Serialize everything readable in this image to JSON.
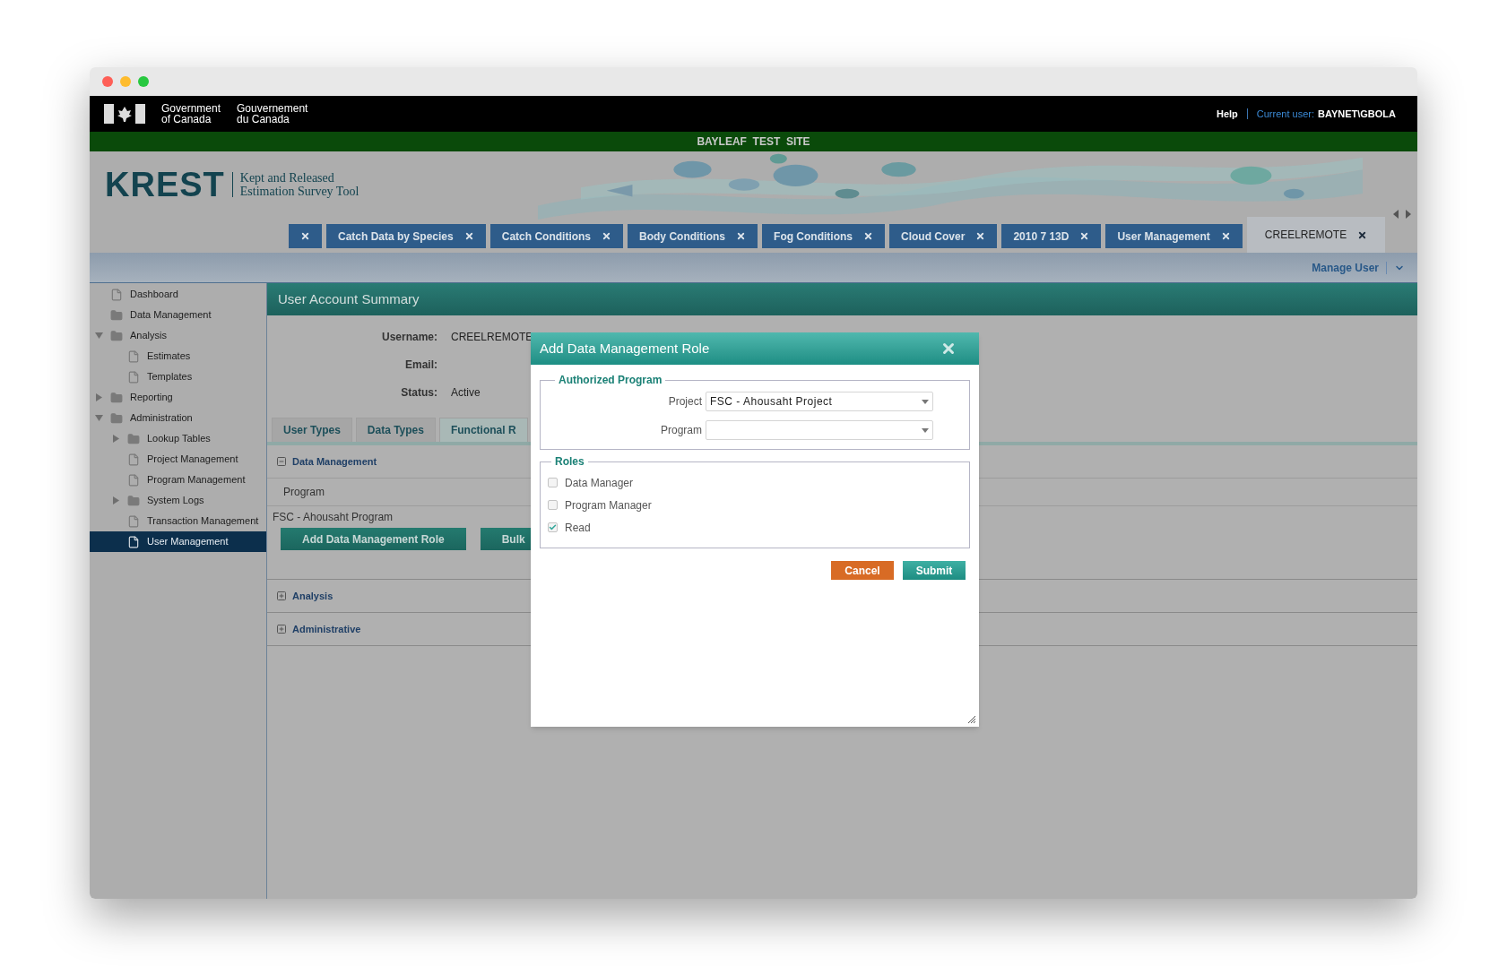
{
  "gov_header": {
    "name_en": [
      "Government",
      "of Canada"
    ],
    "name_fr": [
      "Gouvernement",
      "du Canada"
    ],
    "help": "Help",
    "current_user_label": "Current user:",
    "current_user": "BAYNET\\GBOLA"
  },
  "site_banner": "BAYLEAF  TEST  SITE",
  "app": {
    "logo": "KREST",
    "subtitle": [
      "Kept and Released",
      "Estimation Survey Tool"
    ]
  },
  "tabs": [
    {
      "selected": false
    },
    {
      "label": "Catch Data by Species",
      "selected": false
    },
    {
      "label": "Catch Conditions",
      "selected": false
    },
    {
      "label": "Body Conditions",
      "selected": false
    },
    {
      "label": "Fog Conditions",
      "selected": false
    },
    {
      "label": "Cloud Cover",
      "selected": false
    },
    {
      "label": "2010 7 13D",
      "selected": false
    },
    {
      "label": "User Management",
      "selected": false
    },
    {
      "label": "CREELREMOTE",
      "selected": true
    }
  ],
  "toolbar": {
    "menu": "Manage User"
  },
  "sidebar": {
    "items": [
      {
        "label": "Dashboard",
        "kind": "page",
        "selected": false
      },
      {
        "label": "Data Management",
        "kind": "folder",
        "selected": false
      },
      {
        "label": "Analysis",
        "kind": "folder",
        "selected": false,
        "expanded": true,
        "children": [
          {
            "label": "Estimates",
            "kind": "page",
            "selected": false
          },
          {
            "label": "Templates",
            "kind": "page",
            "selected": false
          }
        ]
      },
      {
        "label": "Reporting",
        "kind": "folder",
        "selected": false,
        "expanded": false
      },
      {
        "label": "Administration",
        "kind": "folder",
        "selected": false,
        "expanded": true,
        "children": [
          {
            "label": "Lookup Tables",
            "kind": "folder",
            "selected": false,
            "expanded": false
          },
          {
            "label": "Project Management",
            "kind": "page",
            "selected": false
          },
          {
            "label": "Program Management",
            "kind": "page",
            "selected": false
          },
          {
            "label": "System Logs",
            "kind": "folder",
            "selected": false,
            "expanded": false
          },
          {
            "label": "Transaction Management",
            "kind": "page",
            "selected": false
          },
          {
            "label": "User Management",
            "kind": "page",
            "selected": true
          }
        ]
      }
    ]
  },
  "main": {
    "title": "User Account Summary",
    "fields": [
      {
        "label": "Username:",
        "value": "CREELREMOTE"
      },
      {
        "label": "Email:"
      },
      {
        "label": "Status:",
        "value": "Active"
      }
    ],
    "tabs": [
      {
        "label": "User Types",
        "selected": false
      },
      {
        "label": "Data Types",
        "selected": false
      },
      {
        "label": "Functional R",
        "selected": true
      }
    ],
    "sections": [
      {
        "title": "Data Management",
        "expanded": true,
        "column": "Program",
        "rows": [
          "FSC - Ahousaht Program"
        ],
        "buttons": [
          "Add Data Management Role",
          "Bulk"
        ]
      },
      {
        "title": "Analysis",
        "expanded": false
      },
      {
        "title": "Administrative",
        "expanded": false
      }
    ]
  },
  "dialog": {
    "title": "Add Data Management Role",
    "program_group": {
      "legend": "Authorized Program",
      "fields": [
        {
          "label": "Project",
          "value": "FSC - Ahousaht Project"
        },
        {
          "label": "Program"
        }
      ]
    },
    "roles_group": {
      "legend": "Roles",
      "roles": [
        {
          "label": "Data Manager",
          "checked": false
        },
        {
          "label": "Program Manager",
          "checked": false
        },
        {
          "label": "Read",
          "checked": true
        }
      ]
    },
    "buttons": [
      {
        "label": "Cancel",
        "kind": "cancel"
      },
      {
        "label": "Submit",
        "kind": "submit"
      }
    ]
  }
}
